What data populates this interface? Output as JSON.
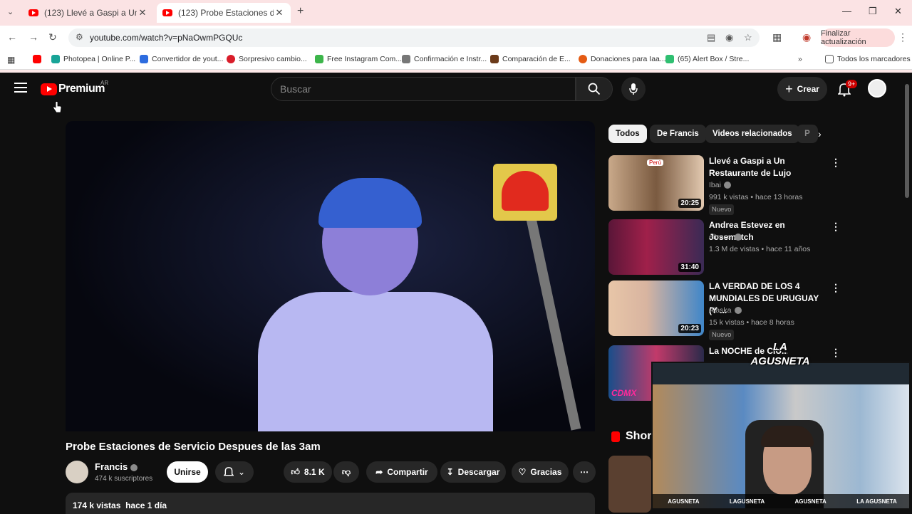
{
  "browser": {
    "tabs": [
      {
        "title": "(123) Llevé a Gaspi a Un Restau",
        "active": false
      },
      {
        "title": "(123) Probe Estaciones de Servi",
        "active": true
      }
    ],
    "url": "youtube.com/watch?v=pNaOwmPGQUc",
    "update_button": "Finalizar actualización",
    "bookmarks": [
      "Photopea | Online P...",
      "Convertidor de yout...",
      "Sorpresivo cambio...",
      "Free Instagram Com...",
      "Confirmación e Instr...",
      "Comparación de E...",
      "Donaciones para Iaa...",
      "(65) Alert Box / Stre..."
    ],
    "all_bookmarks": "Todos los marcadores"
  },
  "youtube": {
    "logo_text": "Premium",
    "country_code": "AR",
    "search_placeholder": "Buscar",
    "create_label": "Crear",
    "notification_count": "9+",
    "video": {
      "title": "Probe Estaciones de Servicio Despues de las 3am",
      "channel": "Francis",
      "subscribers": "474 k suscriptores",
      "join_label": "Unirse",
      "likes": "8.1 K",
      "share_label": "Compartir",
      "download_label": "Descargar",
      "thanks_label": "Gracias",
      "views": "174 k vistas",
      "published": "hace 1 día"
    },
    "chips": [
      "Todos",
      "De Francis",
      "Videos relacionados",
      "P"
    ],
    "recommendations": [
      {
        "title": "Llevé a Gaspi a Un Restaurante de Lujo",
        "channel": "Ibai",
        "meta": "991 k vistas • hace 13 horas",
        "badge": "Nuevo",
        "duration": "20:25",
        "thumb_tag": "Perú"
      },
      {
        "title": "Andrea Estevez en Josematch",
        "channel": "eltrece",
        "meta": "1.3 M de vistas • hace 11 años",
        "badge": "",
        "duration": "31:40",
        "thumb_tag": ""
      },
      {
        "title": "LA VERDAD DE LOS 4 MUNDIALES DE URUGUAY (Y ...",
        "channel": "Alaska",
        "meta": "15 k vistas • hace 8 horas",
        "badge": "Nuevo",
        "duration": "20:23",
        "thumb_tag": ""
      },
      {
        "title": "La NOCHE de CIU... MÉXICO ...",
        "channel": "",
        "meta": "",
        "badge": "",
        "duration": "",
        "thumb_tag": "CDMX"
      }
    ],
    "shorts_label": "Shor"
  },
  "overlay": {
    "streamer_logo": "LA AGUSNETA",
    "socials": [
      "AGUSNETA",
      "LAGUSNETA",
      "AGUSNETA",
      "LA AGUSNETA"
    ]
  },
  "colors": {
    "yt_red": "#ff0000",
    "bg": "#0f0f0f",
    "chip_bg": "#272727"
  }
}
